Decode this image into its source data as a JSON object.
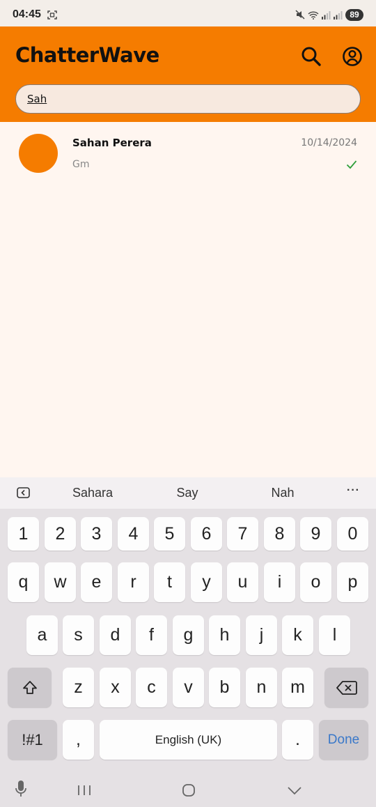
{
  "status_bar": {
    "time": "04:45",
    "battery": "89"
  },
  "header": {
    "title": "ChatterWave",
    "search_icon": "search-icon",
    "profile_icon": "account-circle-icon"
  },
  "search": {
    "value": "Sah"
  },
  "chats": [
    {
      "name": "Sahan Perera",
      "date": "10/14/2024",
      "preview": "Gm",
      "status": "read-check-icon"
    }
  ],
  "colors": {
    "accent": "#f57c00",
    "background": "#fff6f0",
    "check": "#2e9e3a"
  },
  "keyboard": {
    "suggestions": [
      "Sahara",
      "Say",
      "Nah"
    ],
    "more": "···",
    "row_numbers": [
      "1",
      "2",
      "3",
      "4",
      "5",
      "6",
      "7",
      "8",
      "9",
      "0"
    ],
    "row_1": [
      "q",
      "w",
      "e",
      "r",
      "t",
      "y",
      "u",
      "i",
      "o",
      "p"
    ],
    "row_2": [
      "a",
      "s",
      "d",
      "f",
      "g",
      "h",
      "j",
      "k",
      "l"
    ],
    "row_3": [
      "z",
      "x",
      "c",
      "v",
      "b",
      "n",
      "m"
    ],
    "symbols": "!#1",
    "comma": ",",
    "space": "English (UK)",
    "period": ".",
    "done": "Done"
  }
}
